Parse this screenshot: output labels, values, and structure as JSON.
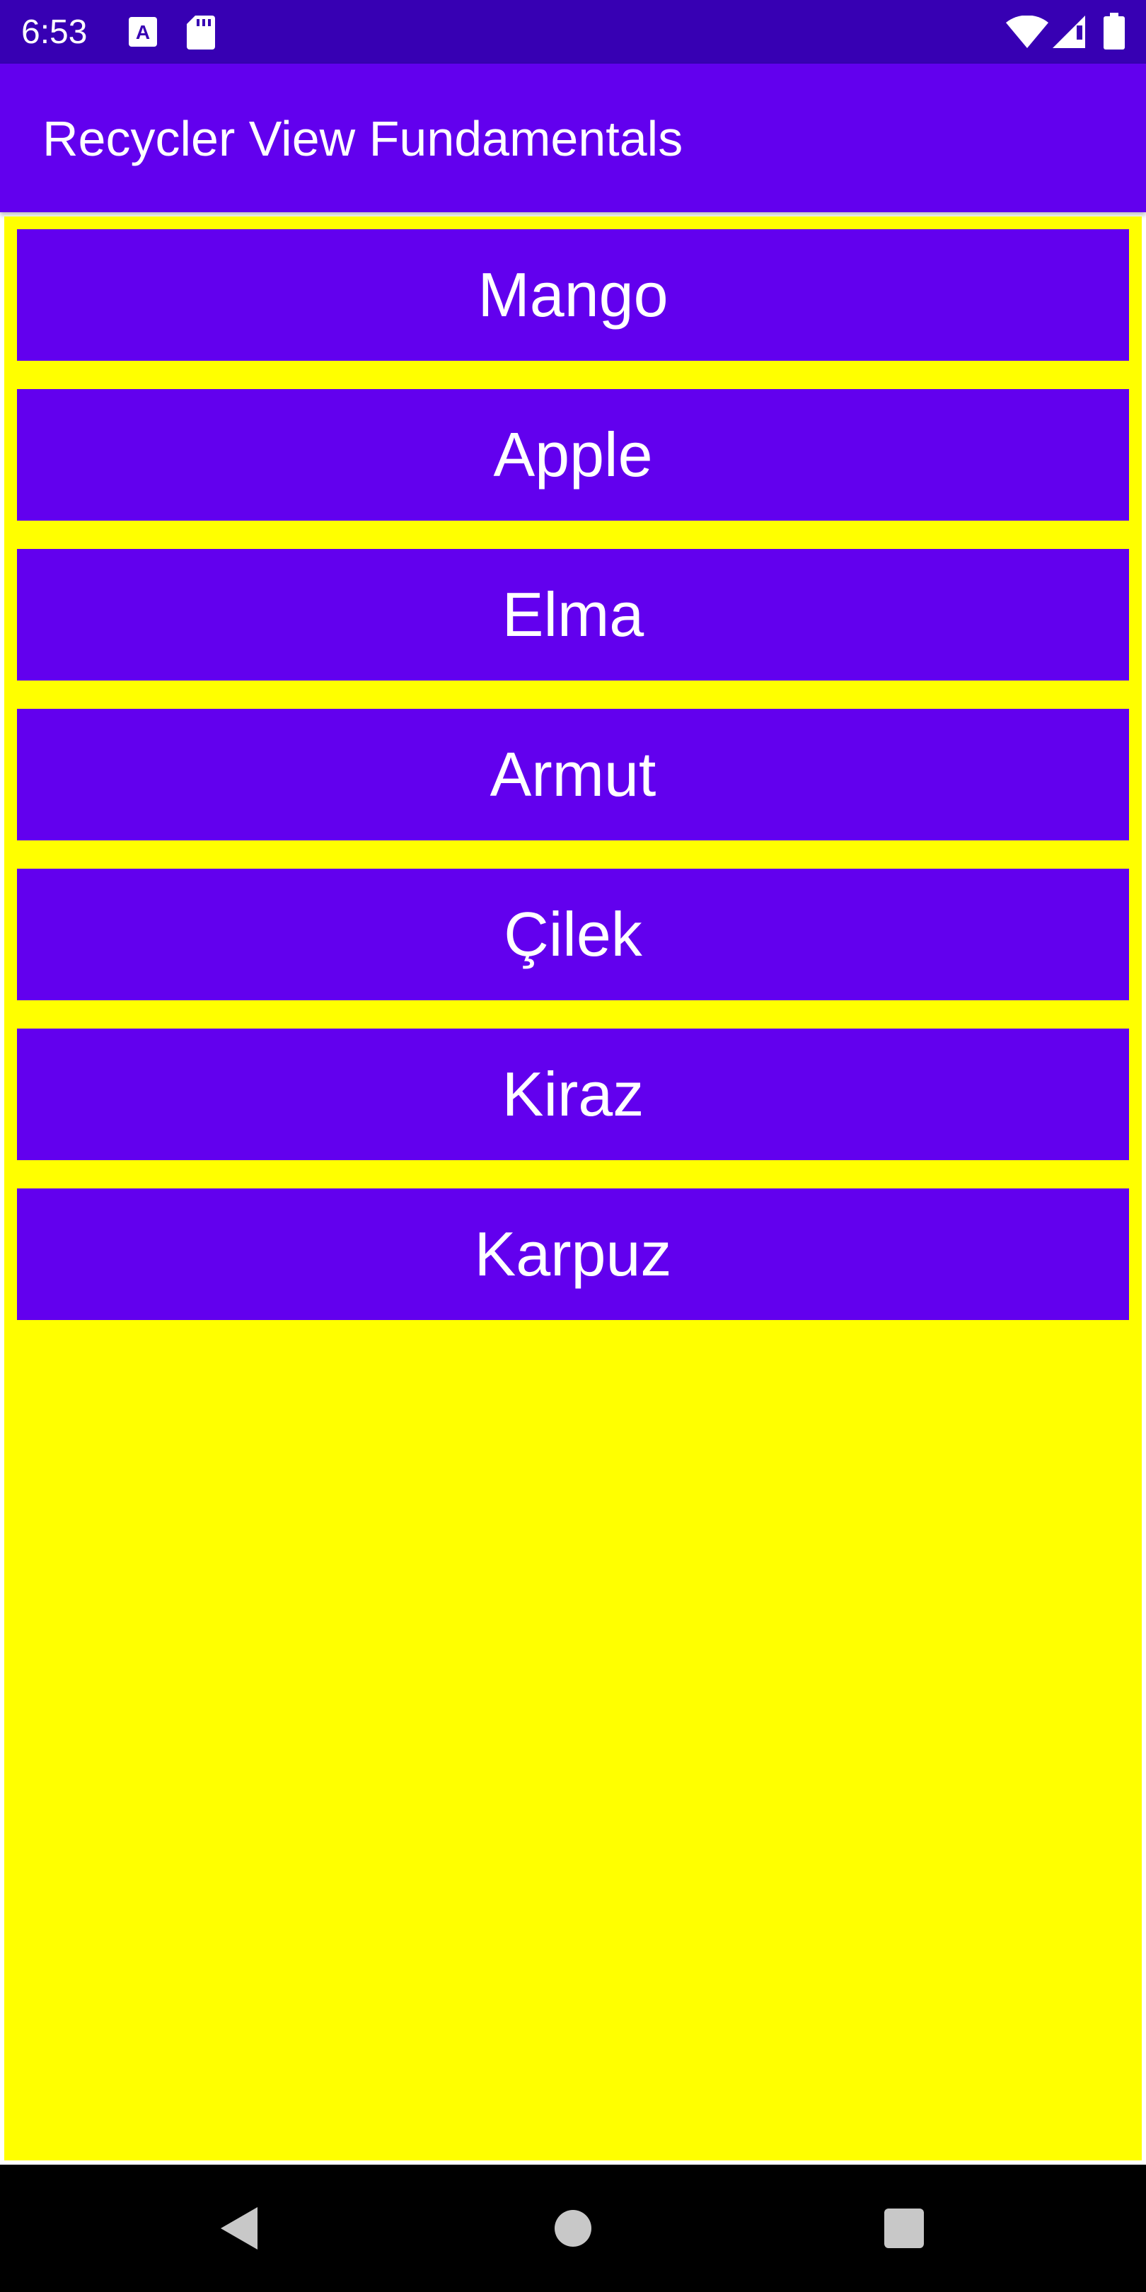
{
  "status_bar": {
    "time": "6:53",
    "icons": [
      "a-notification-icon",
      "sd-card-icon",
      "wifi-icon",
      "signal-icon",
      "battery-icon"
    ]
  },
  "app_bar": {
    "title": "Recycler View Fundamentals"
  },
  "list": {
    "items": [
      {
        "label": "Mango"
      },
      {
        "label": "Apple"
      },
      {
        "label": "Elma"
      },
      {
        "label": "Armut"
      },
      {
        "label": "Çilek"
      },
      {
        "label": "Kiraz"
      },
      {
        "label": "Karpuz"
      }
    ]
  },
  "nav_bar": {
    "buttons": [
      "back-icon",
      "home-icon",
      "recents-icon"
    ]
  },
  "colors": {
    "status_bar": "#3700b3",
    "app_bar": "#6200ee",
    "item_background": "#6200ee",
    "list_background": "#ffff00",
    "nav_bar": "#000000"
  }
}
